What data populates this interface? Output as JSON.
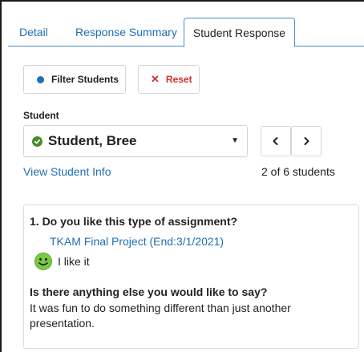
{
  "tabs": [
    {
      "label": "Detail"
    },
    {
      "label": "Response Summary"
    },
    {
      "label": "Student Response",
      "active": true
    }
  ],
  "buttons": {
    "filter_label": "Filter Students",
    "reset_label": "Reset"
  },
  "student": {
    "label": "Student",
    "selected_name": "Student, Bree",
    "status_icon": "check-circle-icon",
    "view_info_link": "View Student Info",
    "position_text": "2 of 6 students"
  },
  "response": {
    "question1": "1. Do you like this type of assignment?",
    "assignment_link": "TKAM Final Project (End:3/1/2021)",
    "answer1": "I like it",
    "answer1_icon": "smiley-face-icon",
    "question2": "Is there anything else you would like to say?",
    "answer2": "It was fun to do something different than just another presentation."
  },
  "colors": {
    "link": "#1f6fb5",
    "reset": "#d32f2f",
    "check": "#4a8c2a",
    "smiley": "#7ac943"
  }
}
